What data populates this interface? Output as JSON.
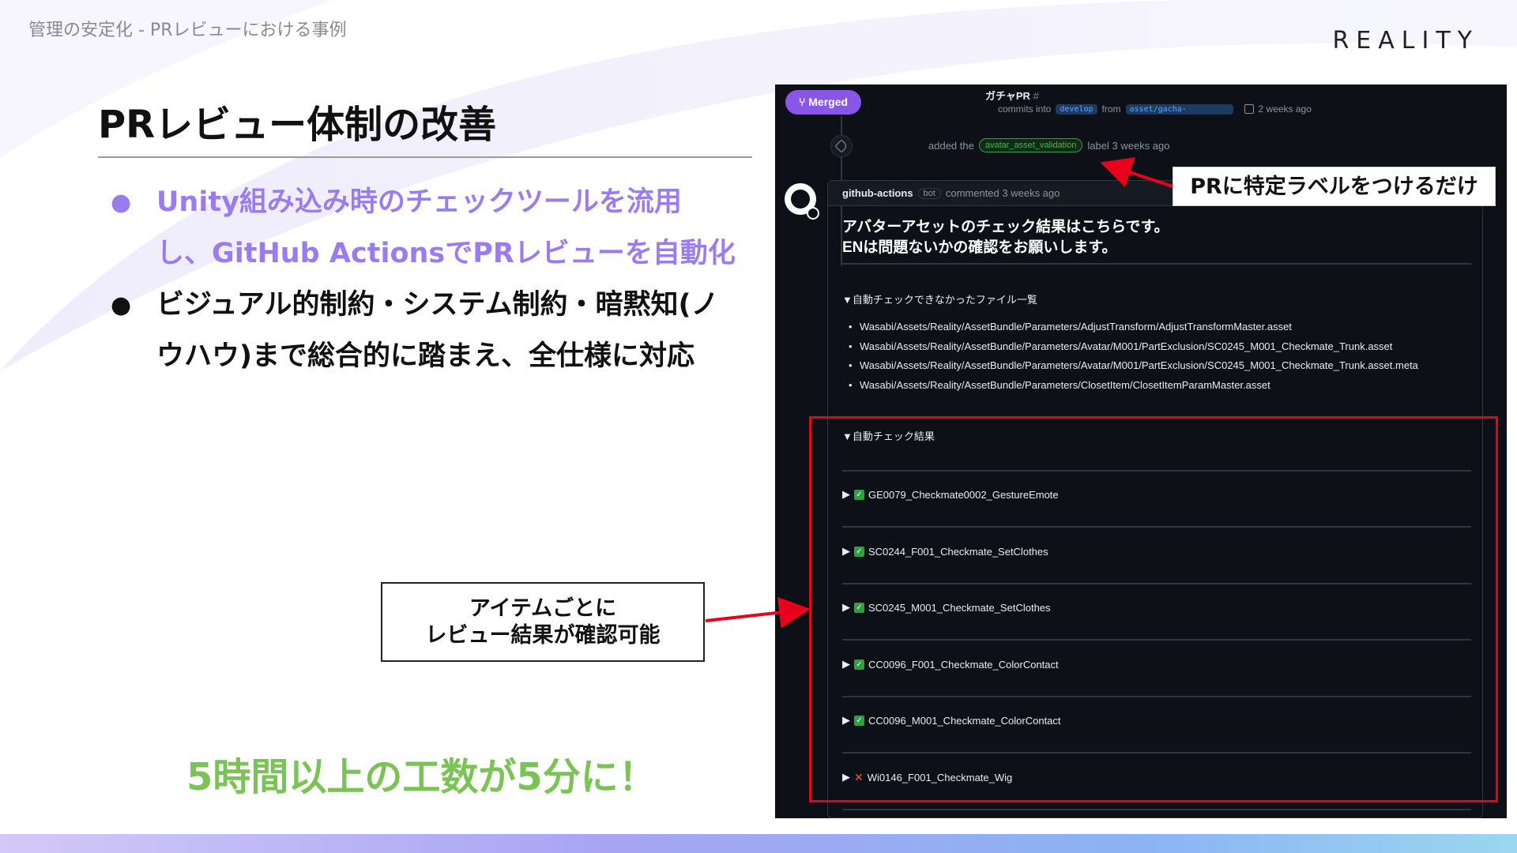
{
  "header": {
    "subtitle": "管理の安定化 - PRレビューにおける事例",
    "logo": "REALITY"
  },
  "slide": {
    "title": "PRレビュー体制の改善",
    "bullets": [
      {
        "line1": "Unity組み込み時のチェックツールを流用",
        "line2": "し、GitHub ActionsでPRレビューを自動化"
      },
      {
        "line1": "ビジュアル的制約・システム制約・暗黙知(ノ",
        "line2": "ウハウ)まで総合的に踏まえ、全仕様に対応"
      }
    ],
    "bullet_marker": "●",
    "callout_line1": "アイテムごとに",
    "callout_line2": "レビュー結果が確認可能",
    "label_callout": "PRに特定ラベルをつけるだけ",
    "highlight": "5時間以上の工数が5分に！"
  },
  "screenshot": {
    "status_badge": "Merged",
    "pr_title": "ガチャPR",
    "pr_hash": "#",
    "meta_commits": "commits into",
    "meta_base_branch": "develop",
    "meta_from": "from",
    "meta_head_branch": "asset/gacha-",
    "meta_time": "2 weeks ago",
    "label_event_prefix": "added the",
    "label_name": "avatar_asset_validation",
    "label_event_suffix": "label 3 weeks ago",
    "comment_author": "github-actions",
    "comment_bot": "bot",
    "comment_time": "commented 3 weeks ago",
    "comment_heading_line1": "アバターアセットのチェック結果はこちらです。",
    "comment_heading_line2": "ENは問題ないかの確認をお願いします。",
    "unchecked_summary": "▼自動チェックできなかったファイル一覧",
    "unchecked_files": [
      "Wasabi/Assets/Reality/AssetBundle/Parameters/AdjustTransform/AdjustTransformMaster.asset",
      "Wasabi/Assets/Reality/AssetBundle/Parameters/Avatar/M001/PartExclusion/SC0245_M001_Checkmate_Trunk.asset",
      "Wasabi/Assets/Reality/AssetBundle/Parameters/Avatar/M001/PartExclusion/SC0245_M001_Checkmate_Trunk.asset.meta",
      "Wasabi/Assets/Reality/AssetBundle/Parameters/ClosetItem/ClosetItemParamMaster.asset"
    ],
    "results_summary": "▼自動チェック結果",
    "expand_marker": "▶",
    "ok_mark": "✓",
    "ng_mark": "✕",
    "check_results": [
      {
        "name": "GE0079_Checkmate0002_GestureEmote",
        "status": "ok"
      },
      {
        "name": "SC0244_F001_Checkmate_SetClothes",
        "status": "ok"
      },
      {
        "name": "SC0245_M001_Checkmate_SetClothes",
        "status": "ok"
      },
      {
        "name": "CC0096_F001_Checkmate_ColorContact",
        "status": "ok"
      },
      {
        "name": "CC0096_M001_Checkmate_ColorContact",
        "status": "ok"
      },
      {
        "name": "Wi0146_F001_Checkmate_Wig",
        "status": "ng"
      }
    ]
  },
  "colors": {
    "accent_purple": "#9b7cf0",
    "highlight_green": "#7cc356",
    "annotation_red": "#e8001c",
    "merged_purple": "#8957e5"
  }
}
